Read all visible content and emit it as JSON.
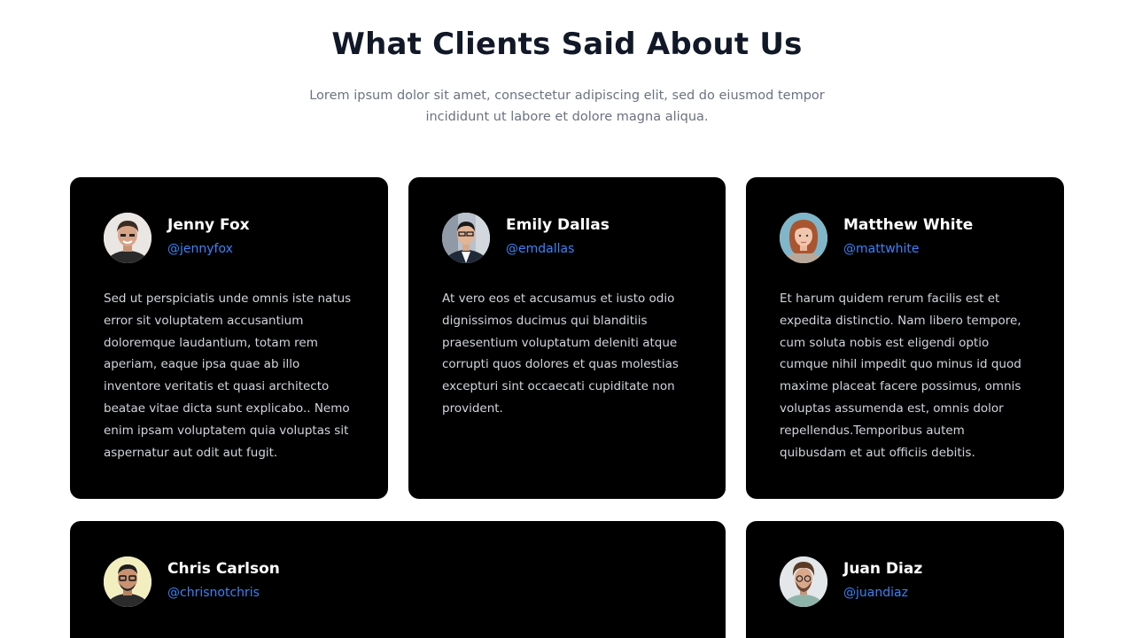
{
  "header": {
    "title": "What Clients Said About Us",
    "subtitle": "Lorem ipsum dolor sit amet, consectetur adipiscing elit, sed do eiusmod tempor incididunt ut labore et dolore magna aliqua."
  },
  "colors": {
    "card_background": "#000000",
    "handle": "#3b82f6",
    "quote_text": "#d1d5db",
    "title": "#111827"
  },
  "testimonials": [
    {
      "name": "Jenny Fox",
      "handle": "@jennyfox",
      "quote": "Sed ut perspiciatis unde omnis iste natus error sit voluptatem accusantium doloremque laudantium, totam rem aperiam, eaque ipsa quae ab illo inventore veritatis et quasi architecto beatae vitae dicta sunt explicabo.. Nemo enim ipsam voluptatem quia voluptas sit aspernatur aut odit aut fugit."
    },
    {
      "name": "Emily Dallas",
      "handle": "@emdallas",
      "quote": "At vero eos et accusamus et iusto odio dignissimos ducimus qui blanditiis praesentium voluptatum deleniti atque corrupti quos dolores et quas molestias excepturi sint occaecati cupiditate non provident."
    },
    {
      "name": "Matthew White",
      "handle": "@mattwhite",
      "quote": "Et harum quidem rerum facilis est et expedita distinctio. Nam libero tempore, cum soluta nobis est eligendi optio cumque nihil impedit quo minus id quod maxime placeat facere possimus, omnis voluptas assumenda est, omnis dolor repellendus.Temporibus autem quibusdam et aut officiis debitis."
    },
    {
      "name": "Chris Carlson",
      "handle": "@chrisnotchris",
      "quote": ""
    },
    {
      "name": "Juan Diaz",
      "handle": "@juandiaz",
      "quote": ""
    }
  ]
}
